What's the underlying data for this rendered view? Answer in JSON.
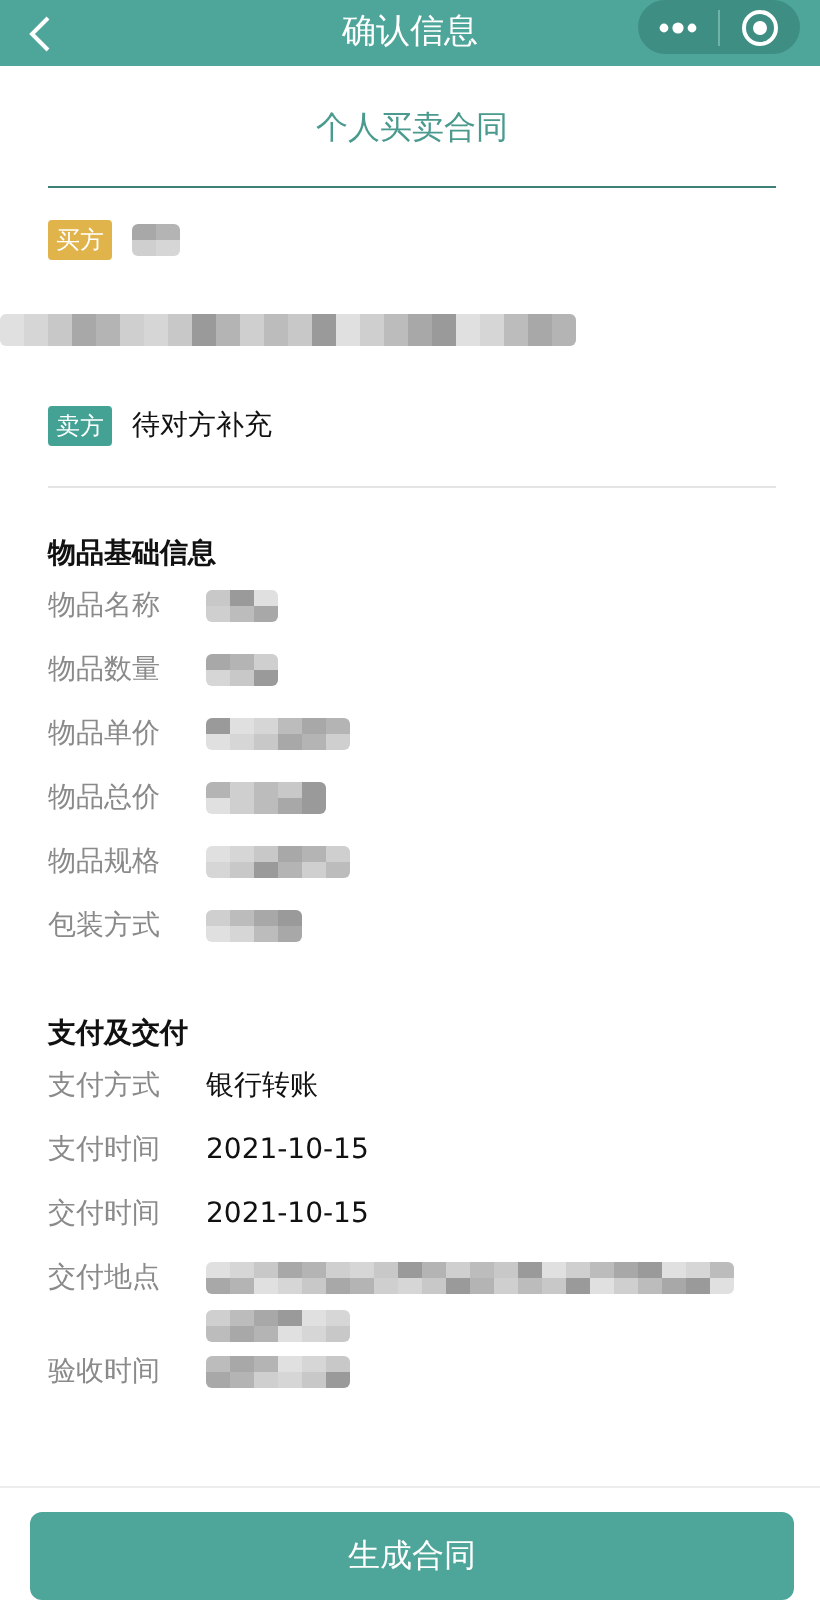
{
  "nav_bar": {
    "title": "确认信息"
  },
  "contract": {
    "title": "个人买卖合同"
  },
  "parties": [
    {
      "kind": "buyer",
      "tag": "买方",
      "name_redacted": true,
      "address_redacted": true
    },
    {
      "kind": "seller",
      "tag": "卖方",
      "name": "待对方补充"
    }
  ],
  "sections": [
    {
      "title": "物品基础信息",
      "rows": [
        {
          "label": "物品名称",
          "redacted": true
        },
        {
          "label": "物品数量",
          "redacted": true
        },
        {
          "label": "物品单价",
          "redacted": true
        },
        {
          "label": "物品总价",
          "redacted": true
        },
        {
          "label": "物品规格",
          "redacted": true
        },
        {
          "label": "包装方式",
          "redacted": true
        }
      ]
    },
    {
      "title": "支付及交付",
      "rows": [
        {
          "label": "支付方式",
          "value": "银行转账"
        },
        {
          "label": "支付时间",
          "value": "2021-10-15"
        },
        {
          "label": "交付时间",
          "value": "2021-10-15"
        },
        {
          "label": "交付地点",
          "redacted": true,
          "multiline": true
        },
        {
          "label": "验收时间",
          "redacted": true
        }
      ]
    }
  ],
  "submit_button": {
    "label": "生成合同"
  }
}
